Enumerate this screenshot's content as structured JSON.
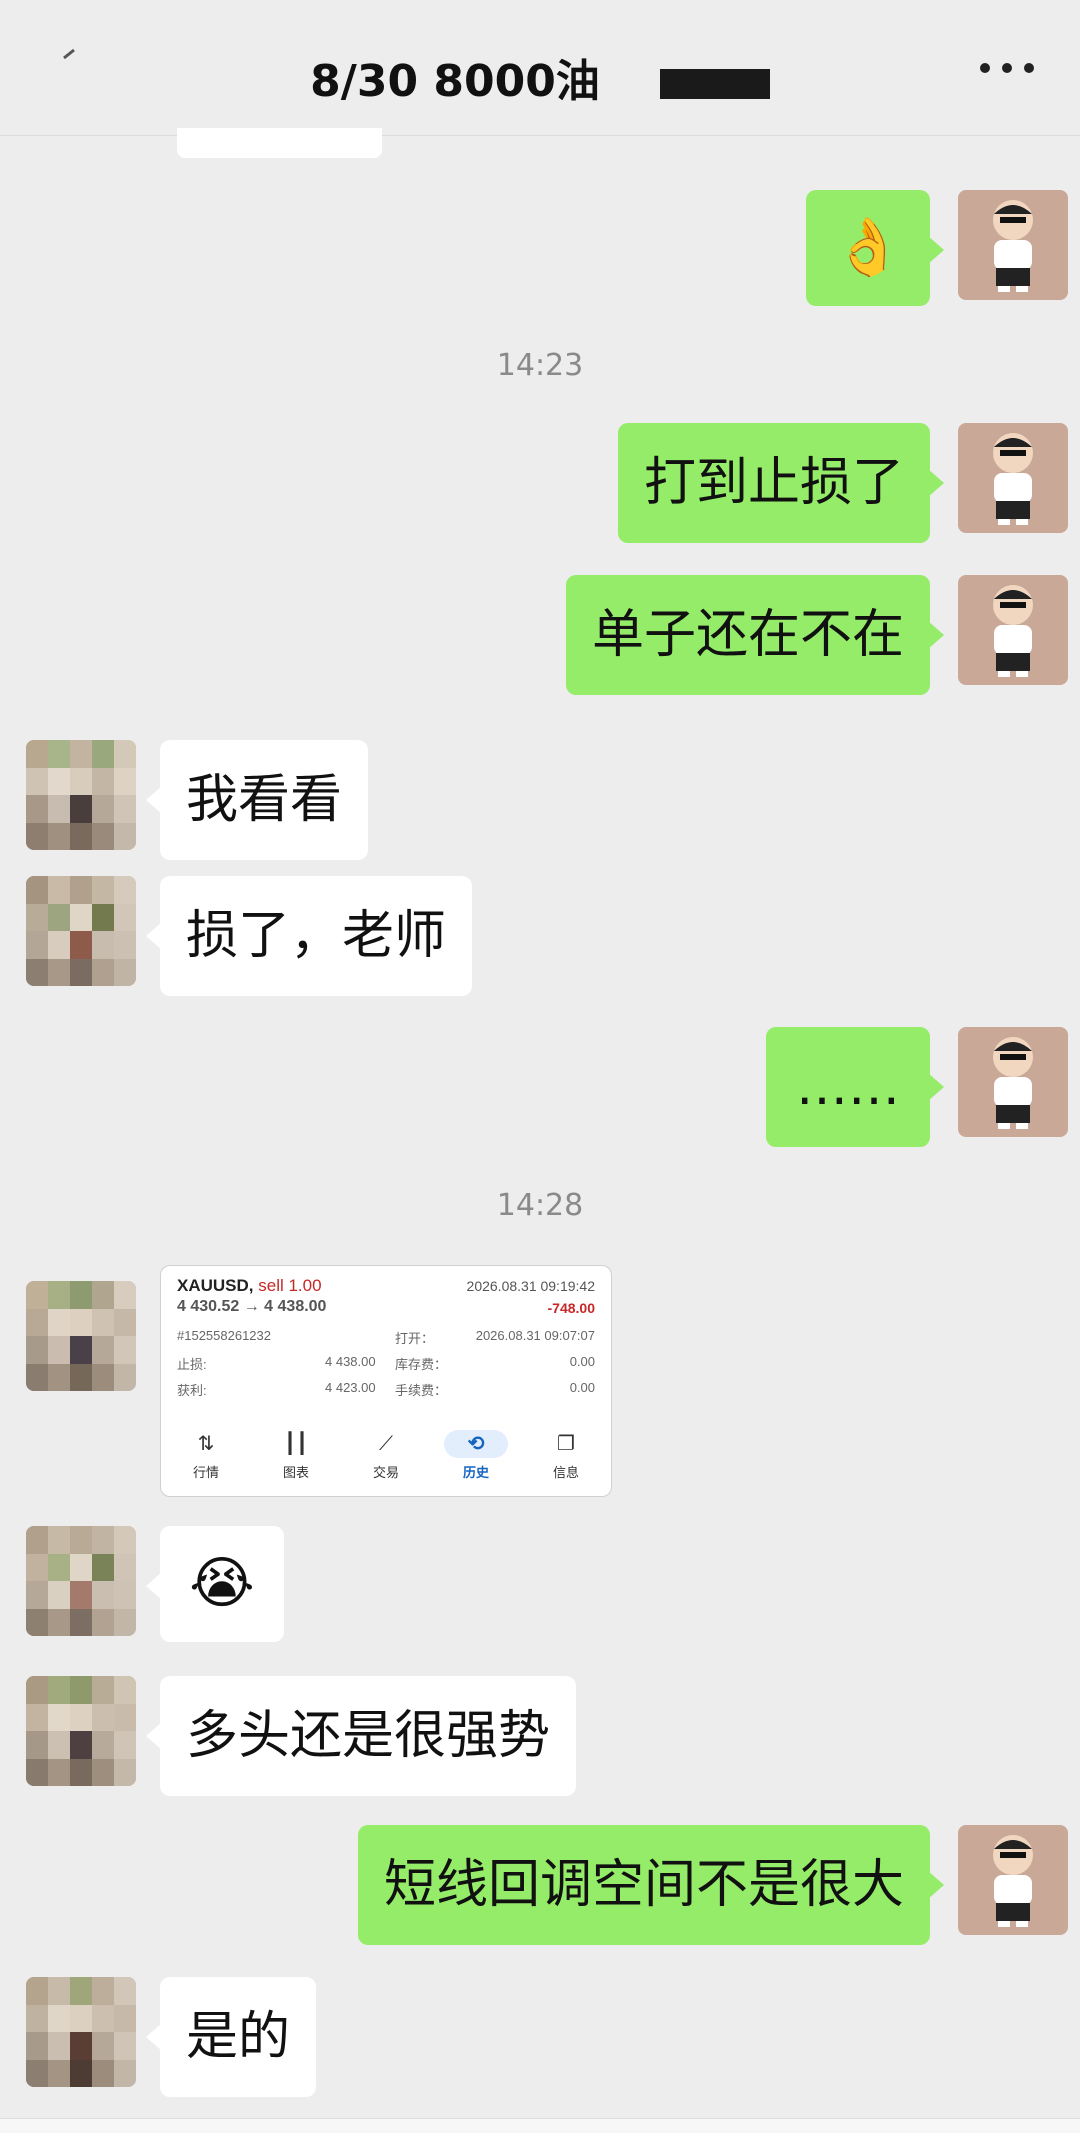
{
  "header": {
    "title": "8/30  8000油"
  },
  "messages": {
    "time1": "14:23",
    "time2": "14:28",
    "m_ok": "👌",
    "m1": "打到止损了",
    "m2": "单子还在不在",
    "m3": "我看看",
    "m4": "损了，老师",
    "m5": "……",
    "m6": "😭",
    "m7": "多头还是很强势",
    "m8": "短线回调空间不是很大",
    "m9": "是的"
  },
  "trade_card": {
    "symbol": "XAUUSD,",
    "side": "sell 1.00",
    "close_time": "2026.08.31 09:19:42",
    "prices": "4 430.52 → 4 438.00",
    "profit": "-748.00",
    "order_id": "#152558261232",
    "open_label": "打开：",
    "open_time": "2026.08.31 09:07:07",
    "sl_label": "止损:",
    "sl_value": "4 438.00",
    "swap_label": "库存费：",
    "swap_value": "0.00",
    "tp_label": "获利:",
    "tp_value": "4 423.00",
    "fee_label": "手续费：",
    "fee_value": "0.00",
    "tabs": [
      "行情",
      "图表",
      "交易",
      "历史",
      "信息"
    ]
  },
  "colors": {
    "bg": "#ededed",
    "my_bubble": "#95ec69",
    "their_bubble": "#ffffff",
    "loss": "#c62828",
    "active_tab": "#1565c0"
  }
}
